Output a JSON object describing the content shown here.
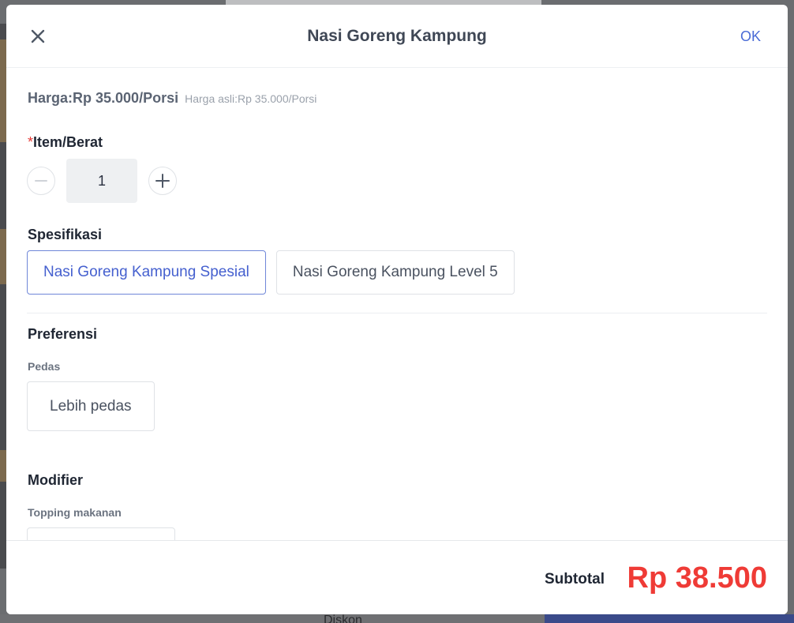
{
  "dialog": {
    "title": "Nasi Goreng Kampung",
    "ok_label": "OK"
  },
  "price": {
    "main": "Harga:Rp 35.000/Porsi",
    "original": "Harga asli:Rp 35.000/Porsi"
  },
  "quantity": {
    "required_mark": "*",
    "label": "Item/Berat",
    "value": "1"
  },
  "specification": {
    "label": "Spesifikasi",
    "options": [
      {
        "label": "Nasi Goreng Kampung Spesial",
        "selected": true
      },
      {
        "label": "Nasi Goreng Kampung Level 5",
        "selected": false
      }
    ]
  },
  "preference": {
    "label": "Preferensi",
    "group_label": "Pedas",
    "options": [
      {
        "label": "Lebih pedas",
        "selected": false
      }
    ]
  },
  "modifier": {
    "label": "Modifier",
    "group_label": "Topping makanan"
  },
  "footer": {
    "subtotal_label": "Subtotal",
    "subtotal_value": "Rp 38.500"
  },
  "background": {
    "bottom_text": "Diskon"
  },
  "colors": {
    "accent": "#4a6bd6",
    "subtotal": "#ef3b36"
  }
}
